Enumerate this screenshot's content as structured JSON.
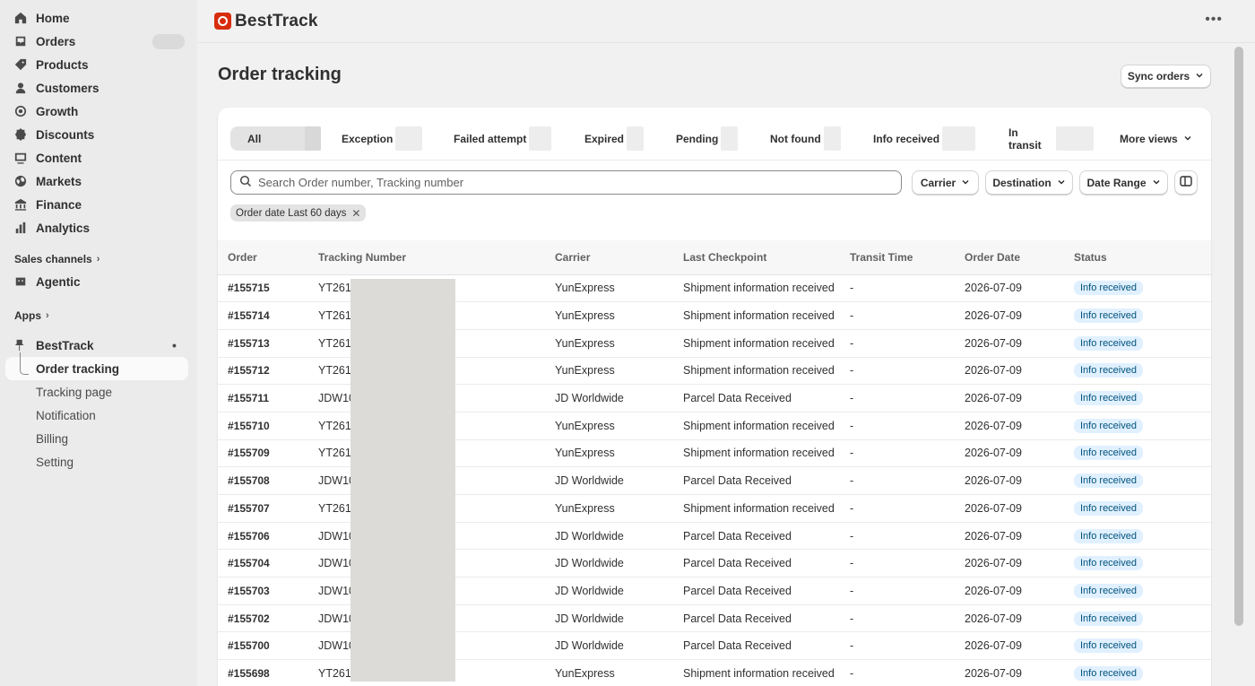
{
  "sidebar": {
    "items": [
      {
        "label": "Home",
        "icon": "home-icon"
      },
      {
        "label": "Orders",
        "icon": "orders-icon"
      },
      {
        "label": "Products",
        "icon": "tag-icon"
      },
      {
        "label": "Customers",
        "icon": "person-icon"
      },
      {
        "label": "Growth",
        "icon": "target-icon"
      },
      {
        "label": "Discounts",
        "icon": "discount-icon"
      },
      {
        "label": "Content",
        "icon": "content-icon"
      },
      {
        "label": "Markets",
        "icon": "globe-icon"
      },
      {
        "label": "Finance",
        "icon": "bank-icon"
      },
      {
        "label": "Analytics",
        "icon": "chart-icon"
      }
    ],
    "sales_channels_label": "Sales channels",
    "agentic_label": "Agentic",
    "apps_label": "Apps",
    "app_name": "BestTrack",
    "app_subitems": [
      "Order tracking",
      "Tracking page",
      "Notification",
      "Billing",
      "Setting"
    ]
  },
  "topbar": {
    "brand": "BestTrack"
  },
  "page": {
    "title": "Order tracking",
    "sync_label": "Sync orders"
  },
  "tabs": [
    "All",
    "Exception",
    "Failed attempt",
    "Expired",
    "Pending",
    "Not found",
    "Info received",
    "In transit"
  ],
  "more_views_label": "More views",
  "search": {
    "placeholder": "Search Order number, Tracking number"
  },
  "filters": {
    "carrier": "Carrier",
    "destination": "Destination",
    "date_range": "Date Range"
  },
  "chip": {
    "label": "Order date Last 60 days"
  },
  "table": {
    "headers": [
      "Order",
      "Tracking Number",
      "Carrier",
      "Last Checkpoint",
      "Transit Time",
      "Order Date",
      "Status"
    ],
    "rows": [
      [
        "#155715",
        "YT261",
        "YunExpress",
        "Shipment information received",
        "-",
        "2026-07-09",
        "Info received"
      ],
      [
        "#155714",
        "YT261",
        "YunExpress",
        "Shipment information received",
        "-",
        "2026-07-09",
        "Info received"
      ],
      [
        "#155713",
        "YT261",
        "YunExpress",
        "Shipment information received",
        "-",
        "2026-07-09",
        "Info received"
      ],
      [
        "#155712",
        "YT261",
        "YunExpress",
        "Shipment information received",
        "-",
        "2026-07-09",
        "Info received"
      ],
      [
        "#155711",
        "JDW10",
        "JD Worldwide",
        "Parcel Data Received",
        "-",
        "2026-07-09",
        "Info received"
      ],
      [
        "#155710",
        "YT261",
        "YunExpress",
        "Shipment information received",
        "-",
        "2026-07-09",
        "Info received"
      ],
      [
        "#155709",
        "YT261",
        "YunExpress",
        "Shipment information received",
        "-",
        "2026-07-09",
        "Info received"
      ],
      [
        "#155708",
        "JDW10",
        "JD Worldwide",
        "Parcel Data Received",
        "-",
        "2026-07-09",
        "Info received"
      ],
      [
        "#155707",
        "YT261",
        "YunExpress",
        "Shipment information received",
        "-",
        "2026-07-09",
        "Info received"
      ],
      [
        "#155706",
        "JDW10",
        "JD Worldwide",
        "Parcel Data Received",
        "-",
        "2026-07-09",
        "Info received"
      ],
      [
        "#155704",
        "JDW10",
        "JD Worldwide",
        "Parcel Data Received",
        "-",
        "2026-07-09",
        "Info received"
      ],
      [
        "#155703",
        "JDW10",
        "JD Worldwide",
        "Parcel Data Received",
        "-",
        "2026-07-09",
        "Info received"
      ],
      [
        "#155702",
        "JDW10",
        "JD Worldwide",
        "Parcel Data Received",
        "-",
        "2026-07-09",
        "Info received"
      ],
      [
        "#155700",
        "JDW10",
        "JD Worldwide",
        "Parcel Data Received",
        "-",
        "2026-07-09",
        "Info received"
      ],
      [
        "#155698",
        "YT261",
        "YunExpress",
        "Shipment information received",
        "-",
        "2026-07-09",
        "Info received"
      ]
    ]
  },
  "colors": {
    "accent": "#303030",
    "badge_bg": "#e0f0ff",
    "badge_text": "#00527c",
    "logo": "#d82c0d"
  }
}
